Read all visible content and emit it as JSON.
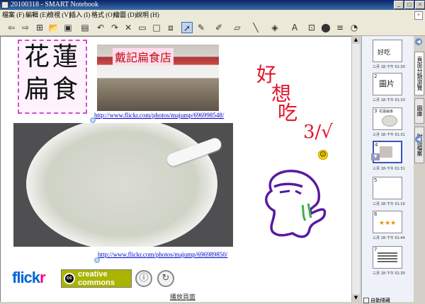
{
  "window": {
    "title": "20100318 - SMART Notebook",
    "controls": {
      "minimize": "_",
      "maximize": "□",
      "close": "×"
    }
  },
  "menu": {
    "items": [
      "檔案 (F)",
      "編輯 (E)",
      "檢視 (V)",
      "插入 (I)",
      "格式 (O)",
      "繪圖 (D)",
      "說明 (H)"
    ],
    "close_doc": "×"
  },
  "toolbar": {
    "buttons": [
      "back-icon",
      "forward-icon",
      "add-page-icon",
      "open-icon",
      "save-icon",
      "paste-icon",
      "undo-icon",
      "redo-icon",
      "delete-icon",
      "screen-shade-icon",
      "full-screen-icon",
      "capture-icon",
      "select-icon",
      "pen-icon",
      "creative-pen-icon",
      "eraser-icon",
      "line-icon",
      "fill-icon",
      "text-icon",
      "properties-icon",
      "more-icon",
      "toolbar-settings-icon",
      "help-icon"
    ],
    "selected": "select-icon"
  },
  "page": {
    "title_chars": [
      "花蓮",
      "扁食"
    ],
    "shop_sign": "戴記扁食店",
    "link1": "http://www.flickr.com/photos/majump/696998548/",
    "link2": "http://www.flickr.com/photos/majump/696989850/",
    "flickr_a": "flick",
    "flickr_b": "r",
    "cc_line1": "creative",
    "cc_line2": "commons",
    "cc_symbol": "cc",
    "attribution_icon": "ⓘ",
    "sharealike_icon": "↻",
    "handwriting": {
      "line1": "好",
      "line2": "想",
      "line3": "吃",
      "scribble": "3/√"
    },
    "bottom_link": "播放頁面"
  },
  "sorter": {
    "thumbs": [
      {
        "num": "",
        "label": "好吃",
        "timestamp": "三月 18-下午 01:30"
      },
      {
        "num": "2",
        "label": "圖片",
        "timestamp": "三月 18-下午 01:33"
      },
      {
        "num": "3",
        "label": "花蓮扁食",
        "timestamp": "三月 18-下午 01:31"
      },
      {
        "num": "4",
        "label": "",
        "timestamp": "三月 18-下午 01:31"
      },
      {
        "num": "5",
        "label": "",
        "timestamp": "三月 18-下午 01:15"
      },
      {
        "num": "6",
        "label": "",
        "timestamp": "三月 18-下午 01:44"
      },
      {
        "num": "7",
        "label": "",
        "timestamp": "三月 18-下午 01:30"
      }
    ],
    "auto_hide": "自動隱藏"
  },
  "side_tabs": [
    "頁面分類瀏覽",
    "圖庫",
    "附加檔案"
  ]
}
